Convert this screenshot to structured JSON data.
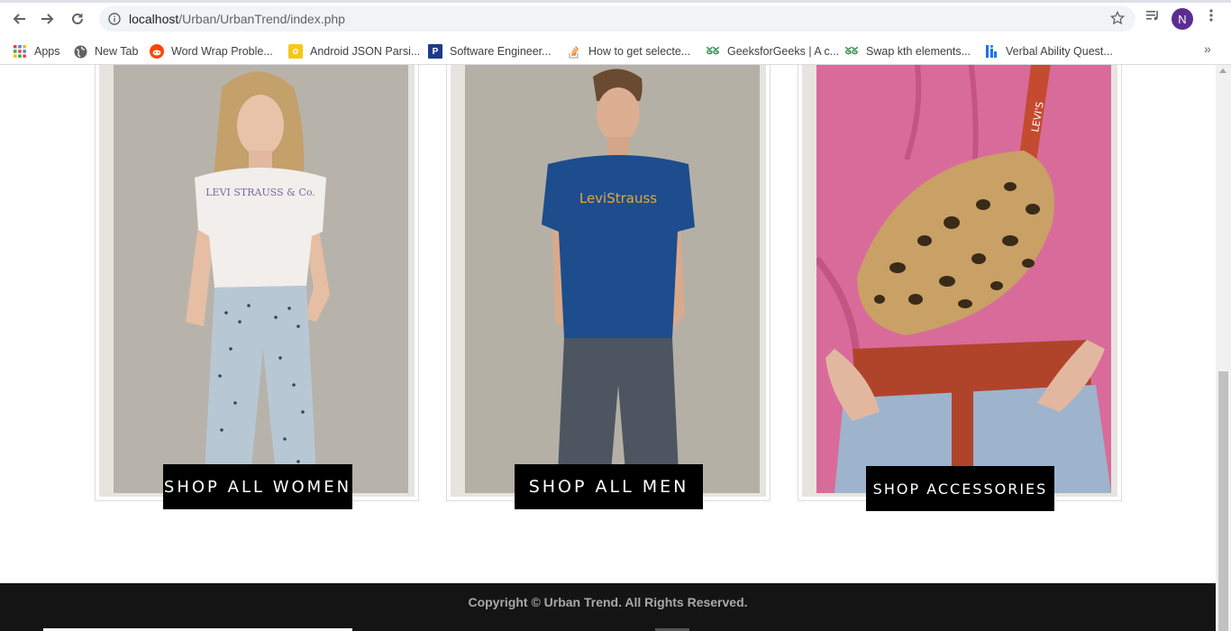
{
  "browser": {
    "url_host": "localhost",
    "url_path": "/Urban/UrbanTrend/index.php",
    "profile_initial": "N",
    "bookmarks": [
      {
        "label": "Apps",
        "icon": "apps-grid-icon"
      },
      {
        "label": "New Tab",
        "icon": "globe-icon"
      },
      {
        "label": "Word Wrap Proble...",
        "icon": "reddit-icon"
      },
      {
        "label": "Android JSON Parsi...",
        "icon": "bookmark-yellow-icon"
      },
      {
        "label": "Software Engineer...",
        "icon": "p-icon"
      },
      {
        "label": "How to get selecte...",
        "icon": "stackoverflow-icon"
      },
      {
        "label": "GeeksforGeeks | A c...",
        "icon": "gfg-icon"
      },
      {
        "label": "Swap kth elements...",
        "icon": "gfg-icon"
      },
      {
        "label": "Verbal Ability Quest...",
        "icon": "indiabix-icon"
      }
    ],
    "more_glyph": "»"
  },
  "products": [
    {
      "button_label": "SHOP ALL WOMEN",
      "shirt_text": "LEVI STRAUSS & Co."
    },
    {
      "button_label": "SHOP ALL MEN",
      "shirt_text": "LeviStrauss"
    },
    {
      "button_label": "SHOP ACCESSORIES",
      "shirt_text": "LEVI'S"
    }
  ],
  "footer": {
    "copyright": "Copyright © Urban Trend. All Rights Reserved."
  },
  "colors": {
    "footer_bg": "#141414",
    "button_bg": "#000000",
    "avatar_bg": "#5c2d91"
  }
}
